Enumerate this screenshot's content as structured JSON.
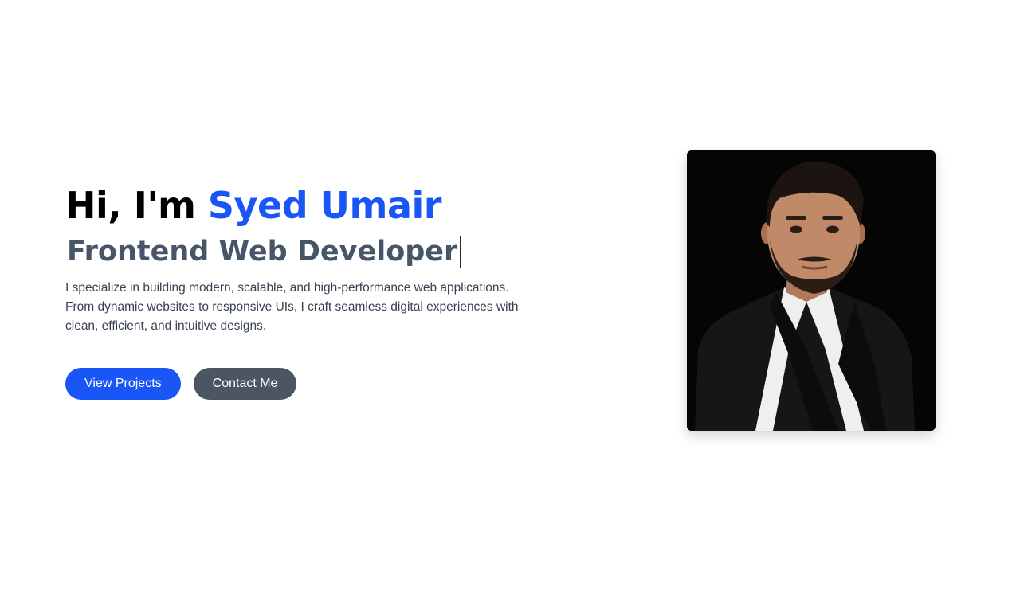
{
  "hero": {
    "greeting_prefix": "Hi, I'm ",
    "name": "Syed Umair",
    "role": "Frontend Web Developer",
    "description": "I specialize in building modern, scalable, and high-performance web applications. From dynamic websites to responsive UIs, I craft seamless digital experiences with clean, efficient, and intuitive designs.",
    "buttons": {
      "primary": "View Projects",
      "secondary": "Contact Me"
    }
  },
  "colors": {
    "accent": "#1a56f5",
    "role_text": "#475569",
    "secondary_button": "#4b5563",
    "photo_background": "#050505"
  },
  "profile_photo": {
    "alt": "Profile photo of Syed Umair"
  }
}
